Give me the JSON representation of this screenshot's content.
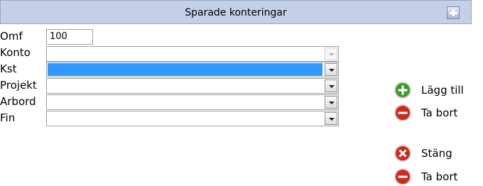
{
  "header": {
    "title": "Sparade konteringar",
    "add_icon": "plus-square-icon"
  },
  "form": {
    "omf": {
      "label": "Omf",
      "value": "100"
    },
    "konto": {
      "label": "Konto",
      "value": ""
    },
    "kst": {
      "label": "Kst",
      "value": ""
    },
    "projekt": {
      "label": "Projekt",
      "value": ""
    },
    "arbord": {
      "label": "Arbord",
      "value": ""
    },
    "fin": {
      "label": "Fin",
      "value": ""
    }
  },
  "actions": {
    "add": {
      "label": "Lägg till",
      "icon": "plus-circle-icon",
      "color": "#3c9a2b"
    },
    "remove": {
      "label": "Ta bort",
      "icon": "minus-circle-icon",
      "color": "#cc2a1f"
    },
    "close": {
      "label": "Stäng",
      "icon": "close-circle-icon",
      "color": "#cc2a1f"
    },
    "remove2": {
      "label": "Ta bort",
      "icon": "minus-circle-icon",
      "color": "#cc2a1f"
    }
  },
  "colors": {
    "header_bg": "#c4d0e5",
    "selected_bg": "#3399ff"
  }
}
